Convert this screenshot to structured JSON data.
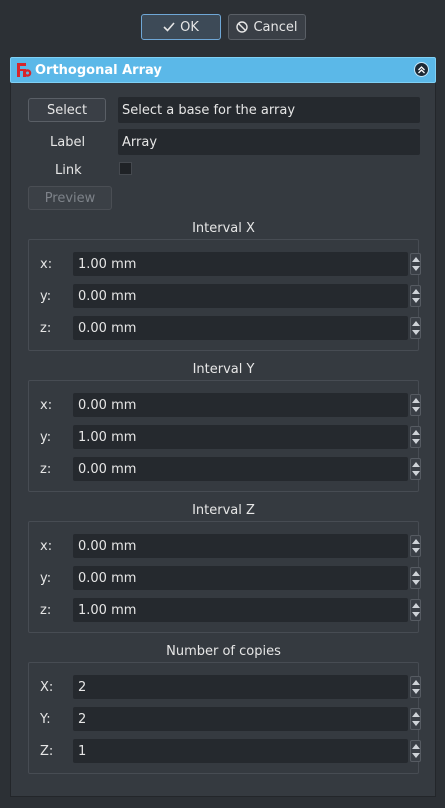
{
  "dialog": {
    "ok_label": "OK",
    "cancel_label": "Cancel"
  },
  "panel": {
    "title": "Orthogonal Array",
    "select_label": "Select",
    "base_field_value": "Select a base for the array",
    "label_caption": "Label",
    "label_value": "Array",
    "link_caption": "Link",
    "link_checked": false,
    "preview_label": "Preview"
  },
  "groups": [
    {
      "title": "Interval X",
      "rows": [
        {
          "label": "x:",
          "value": "1.00 mm"
        },
        {
          "label": "y:",
          "value": "0.00 mm"
        },
        {
          "label": "z:",
          "value": "0.00 mm"
        }
      ]
    },
    {
      "title": "Interval Y",
      "rows": [
        {
          "label": "x:",
          "value": "0.00 mm"
        },
        {
          "label": "y:",
          "value": "1.00 mm"
        },
        {
          "label": "z:",
          "value": "0.00 mm"
        }
      ]
    },
    {
      "title": "Interval Z",
      "rows": [
        {
          "label": "x:",
          "value": "0.00 mm"
        },
        {
          "label": "y:",
          "value": "0.00 mm"
        },
        {
          "label": "z:",
          "value": "1.00 mm"
        }
      ]
    },
    {
      "title": "Number of copies",
      "rows": [
        {
          "label": "X:",
          "value": "2"
        },
        {
          "label": "Y:",
          "value": "2"
        },
        {
          "label": "Z:",
          "value": "1"
        }
      ]
    }
  ],
  "colors": {
    "header_accent": "#5bb8e8",
    "background": "#2c3035",
    "panel": "#353a40",
    "field": "#25292e"
  }
}
